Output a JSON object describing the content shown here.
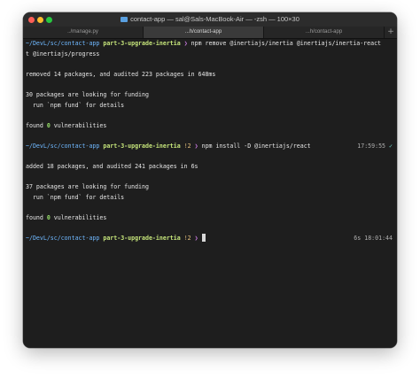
{
  "window": {
    "title": "contact-app — sal@Sals-MacBook-Air — -zsh — 100×30",
    "folder_icon": "folder-icon"
  },
  "tabs": [
    {
      "label": "../manage.py",
      "active": false
    },
    {
      "label": "...h/contact-app",
      "active": true
    },
    {
      "label": "...h/contact-app",
      "active": false
    }
  ],
  "new_tab_label": "+",
  "terminal": {
    "prompt1": {
      "path": "~/DevL/sc/contact-app",
      "branch": "part-3-upgrade-inertia",
      "dirty": "",
      "arrow": "❯",
      "command": "npm remove @inertiajs/inertia @inertiajs/inertia-react",
      "wrap": "t @inertiajs/progress"
    },
    "out1": {
      "removed": "removed 14 packages, and audited 223 packages in 648ms",
      "funding": "30 packages are looking for funding",
      "fund_hint": "  run `npm fund` for details",
      "found_pre": "found ",
      "found_zero": "0",
      "found_post": " vulnerabilities"
    },
    "prompt2": {
      "path": "~/DevL/sc/contact-app",
      "branch": "part-3-upgrade-inertia",
      "dirty": "!2",
      "arrow": "❯",
      "command": "npm install -D @inertiajs/react",
      "time": "17:59:55",
      "check": "✓"
    },
    "out2": {
      "added": "added 18 packages, and audited 241 packages in 6s",
      "funding": "37 packages are looking for funding",
      "fund_hint": "  run `npm fund` for details",
      "found_pre": "found ",
      "found_zero": "0",
      "found_post": " vulnerabilities"
    },
    "prompt3": {
      "path": "~/DevL/sc/contact-app",
      "branch": "part-3-upgrade-inertia",
      "dirty": "!2",
      "arrow": "❯",
      "duration": "6s",
      "time": "18:01:44"
    }
  },
  "colors": {
    "background": "#1e1e1e",
    "path": "#6fb8ff",
    "branch": "#c5e47a",
    "arrow": "#c678dd",
    "success": "#98e06b"
  }
}
